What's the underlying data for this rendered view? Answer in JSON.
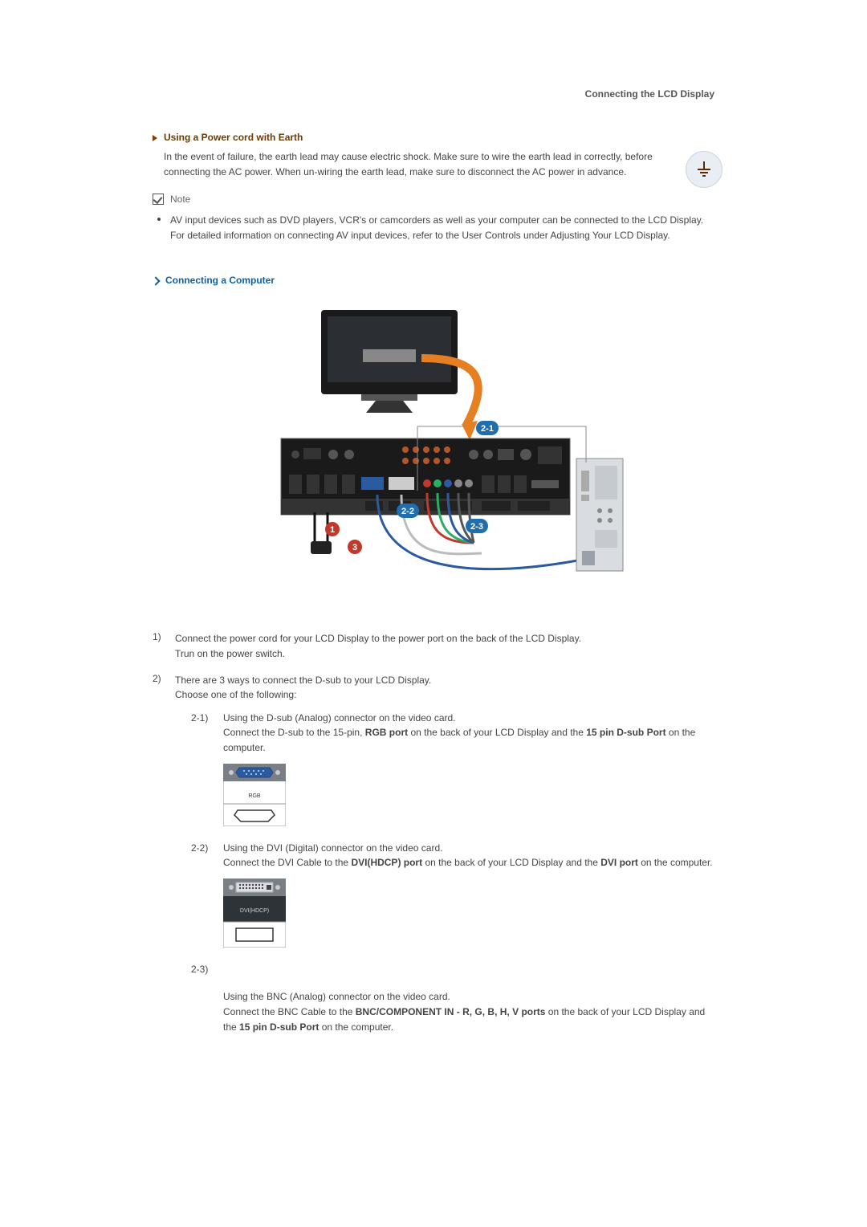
{
  "header": {
    "title": "Connecting the LCD Display"
  },
  "section_earth": {
    "title": "Using a Power cord with Earth",
    "body": "In the event of failure, the earth lead may cause electric shock. Make sure to wire the earth lead in correctly, before connecting the AC power. When un-wiring the earth lead, make sure to disconnect the AC power in advance."
  },
  "note": {
    "label": "Note",
    "bullet": "AV input devices such as DVD players, VCR's or camcorders as well as your computer can be connected to the LCD Display. For detailed information on connecting AV input devices, refer to the User Controls under Adjusting Your LCD Display."
  },
  "section_connect": {
    "title": "Connecting a Computer"
  },
  "diagram": {
    "callout_2_1": "2-1",
    "callout_2_2": "2-2",
    "callout_2_3": "2-3",
    "callout_1": "1",
    "callout_3": "3"
  },
  "steps": {
    "s1": {
      "num": "1)",
      "line1": "Connect the power cord for your LCD Display to the power port on the back of the LCD Display.",
      "line2": "Trun on the power switch."
    },
    "s2": {
      "num": "2)",
      "line1": "There are 3 ways to connect the D-sub to your LCD Display.",
      "line2": "Choose one of the following:",
      "sub": {
        "a": {
          "num": "2-1)",
          "line1": "Using the D-sub (Analog) connector on the video card.",
          "line2a": "Connect the D-sub to the 15-pin, ",
          "bold1": "RGB port",
          "line2b": " on the back of your LCD Display and the ",
          "bold2": "15 pin D-sub Port",
          "line2c": " on the computer.",
          "port_label": "RGB"
        },
        "b": {
          "num": "2-2)",
          "line1": "Using the DVI (Digital) connector on the video card.",
          "line2a": "Connect the DVI Cable to the ",
          "bold1": "DVI(HDCP) port",
          "line2b": " on the back of your LCD Display and the ",
          "bold2": "DVI port",
          "line2c": " on the computer.",
          "port_label": "DVI(HDCP)"
        },
        "c": {
          "num": "2-3)",
          "line1": "Using the BNC (Analog) connector on the video card.",
          "line2a": "Connect the BNC Cable to the ",
          "bold1": "BNC/COMPONENT IN - R, G, B, H, V ports",
          "line2b": " on the back of your LCD Display and the ",
          "bold2": "15 pin D-sub Port",
          "line2c": " on the computer."
        }
      }
    }
  }
}
